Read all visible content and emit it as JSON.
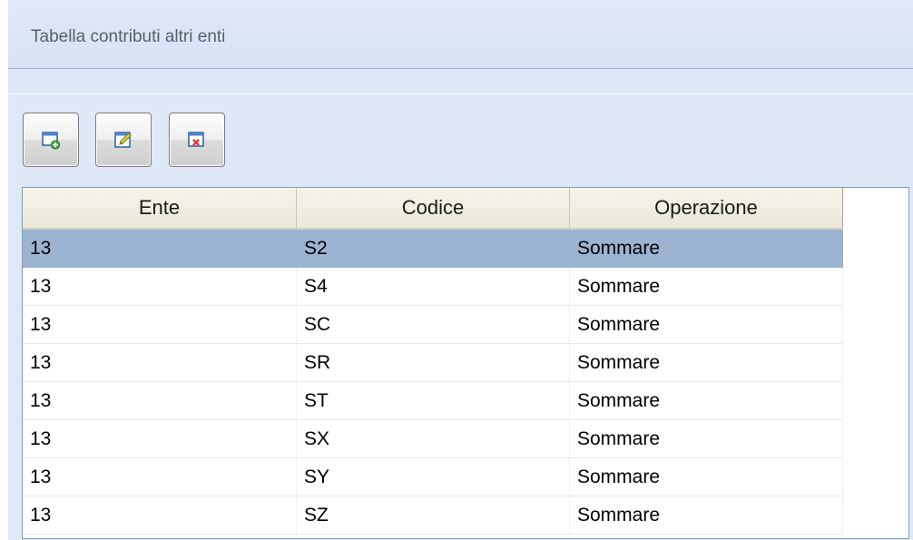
{
  "window": {
    "title": "Tabella contributi altri enti"
  },
  "toolbar": {
    "buttons": [
      {
        "icon": "add-record-icon"
      },
      {
        "icon": "edit-record-icon"
      },
      {
        "icon": "delete-record-icon"
      }
    ]
  },
  "table": {
    "columns": [
      "Ente",
      "Codice",
      "Operazione"
    ],
    "rows": [
      {
        "ente": "13",
        "codice": "S2",
        "operazione": "Sommare",
        "selected": true
      },
      {
        "ente": "13",
        "codice": "S4",
        "operazione": "Sommare",
        "selected": false
      },
      {
        "ente": "13",
        "codice": "SC",
        "operazione": "Sommare",
        "selected": false
      },
      {
        "ente": "13",
        "codice": "SR",
        "operazione": "Sommare",
        "selected": false
      },
      {
        "ente": "13",
        "codice": "ST",
        "operazione": "Sommare",
        "selected": false
      },
      {
        "ente": "13",
        "codice": "SX",
        "operazione": "Sommare",
        "selected": false
      },
      {
        "ente": "13",
        "codice": "SY",
        "operazione": "Sommare",
        "selected": false
      },
      {
        "ente": "13",
        "codice": "SZ",
        "operazione": "Sommare",
        "selected": false
      }
    ]
  },
  "colors": {
    "selected_row": "#9db3d2",
    "window_background": "#dbe6f7",
    "header_background": "#f3f1e4"
  }
}
